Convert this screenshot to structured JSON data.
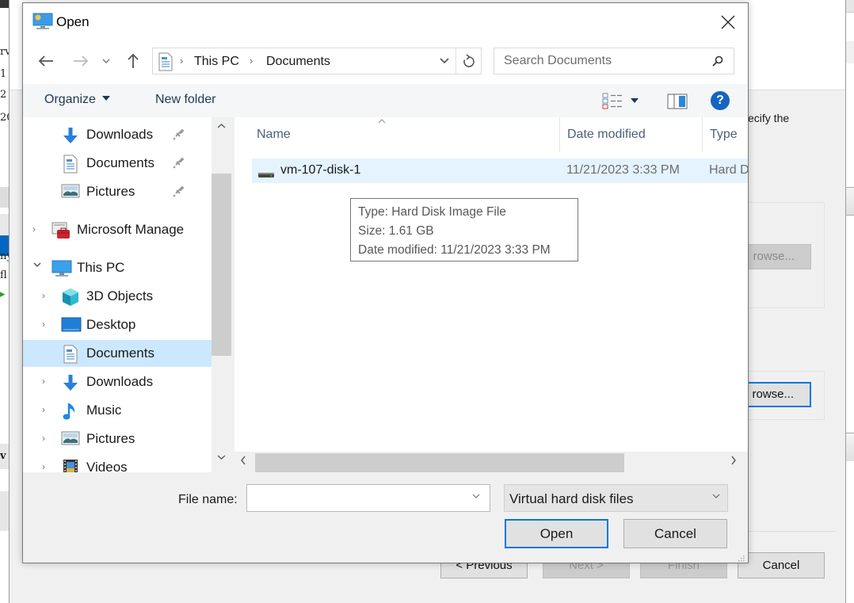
{
  "background": {
    "left_strip_lines": [
      "rv",
      "1",
      "2",
      "20",
      "ny",
      "fl",
      "v"
    ],
    "instruction_fragment": "ecify the",
    "browse_disabled_label": "rowse...",
    "browse_focused_label": "rowse...",
    "nav_buttons": {
      "previous": "< Previous",
      "next": "Next >",
      "finish": "Finish",
      "cancel": "Cancel"
    }
  },
  "dialog": {
    "title": "Open",
    "icons": {
      "app": "monitor-sun-icon",
      "close": "close-icon",
      "back": "arrow-left-icon",
      "forward": "arrow-right-icon",
      "recent": "chevron-down-icon",
      "up": "arrow-up-icon",
      "refresh": "refresh-icon",
      "search": "search-icon",
      "views": "details-view-icon",
      "preview": "preview-pane-icon",
      "help": "help-icon"
    },
    "address": {
      "crumbs": [
        "This PC",
        "Documents"
      ]
    },
    "search": {
      "placeholder": "Search Documents",
      "value": ""
    },
    "toolbar": {
      "organize_label": "Organize",
      "new_folder_label": "New folder",
      "help_glyph": "?"
    },
    "nav_pane": {
      "quick_access": [
        {
          "label": "Downloads",
          "icon": "download-arrow-icon",
          "pinned": true
        },
        {
          "label": "Documents",
          "icon": "document-icon",
          "pinned": true
        },
        {
          "label": "Pictures",
          "icon": "pictures-icon",
          "pinned": true
        }
      ],
      "tree": [
        {
          "label": "Microsoft Manage",
          "icon": "toolbox-icon",
          "expanded": false
        },
        {
          "label": "This PC",
          "icon": "computer-icon",
          "expanded": true
        }
      ],
      "this_pc_children": [
        {
          "label": "3D Objects",
          "icon": "cube-icon"
        },
        {
          "label": "Desktop",
          "icon": "desktop-icon"
        },
        {
          "label": "Documents",
          "icon": "document-icon",
          "selected": true
        },
        {
          "label": "Downloads",
          "icon": "download-arrow-icon"
        },
        {
          "label": "Music",
          "icon": "music-note-icon"
        },
        {
          "label": "Pictures",
          "icon": "pictures-icon"
        },
        {
          "label": "Videos",
          "icon": "film-icon"
        }
      ]
    },
    "file_list": {
      "columns": [
        "Name",
        "Date modified",
        "Type"
      ],
      "rows": [
        {
          "name": "vm-107-disk-1",
          "date_modified": "11/21/2023 3:33 PM",
          "type": "Hard Disk",
          "icon": "hard-disk-icon",
          "hovered": true
        }
      ],
      "tooltip": {
        "type_line": "Type: Hard Disk Image File",
        "size_line": "Size: 1.61 GB",
        "date_line": "Date modified: 11/21/2023 3:33 PM"
      }
    },
    "footer": {
      "file_name_label": "File name:",
      "file_name_value": "",
      "file_type_selected": "Virtual hard disk files",
      "open_label": "Open",
      "cancel_label": "Cancel"
    },
    "colors": {
      "accent": "#0078d7",
      "selection": "#cce8ff",
      "hover_row": "#e5f3ff",
      "help_blue": "#1565c0"
    }
  }
}
